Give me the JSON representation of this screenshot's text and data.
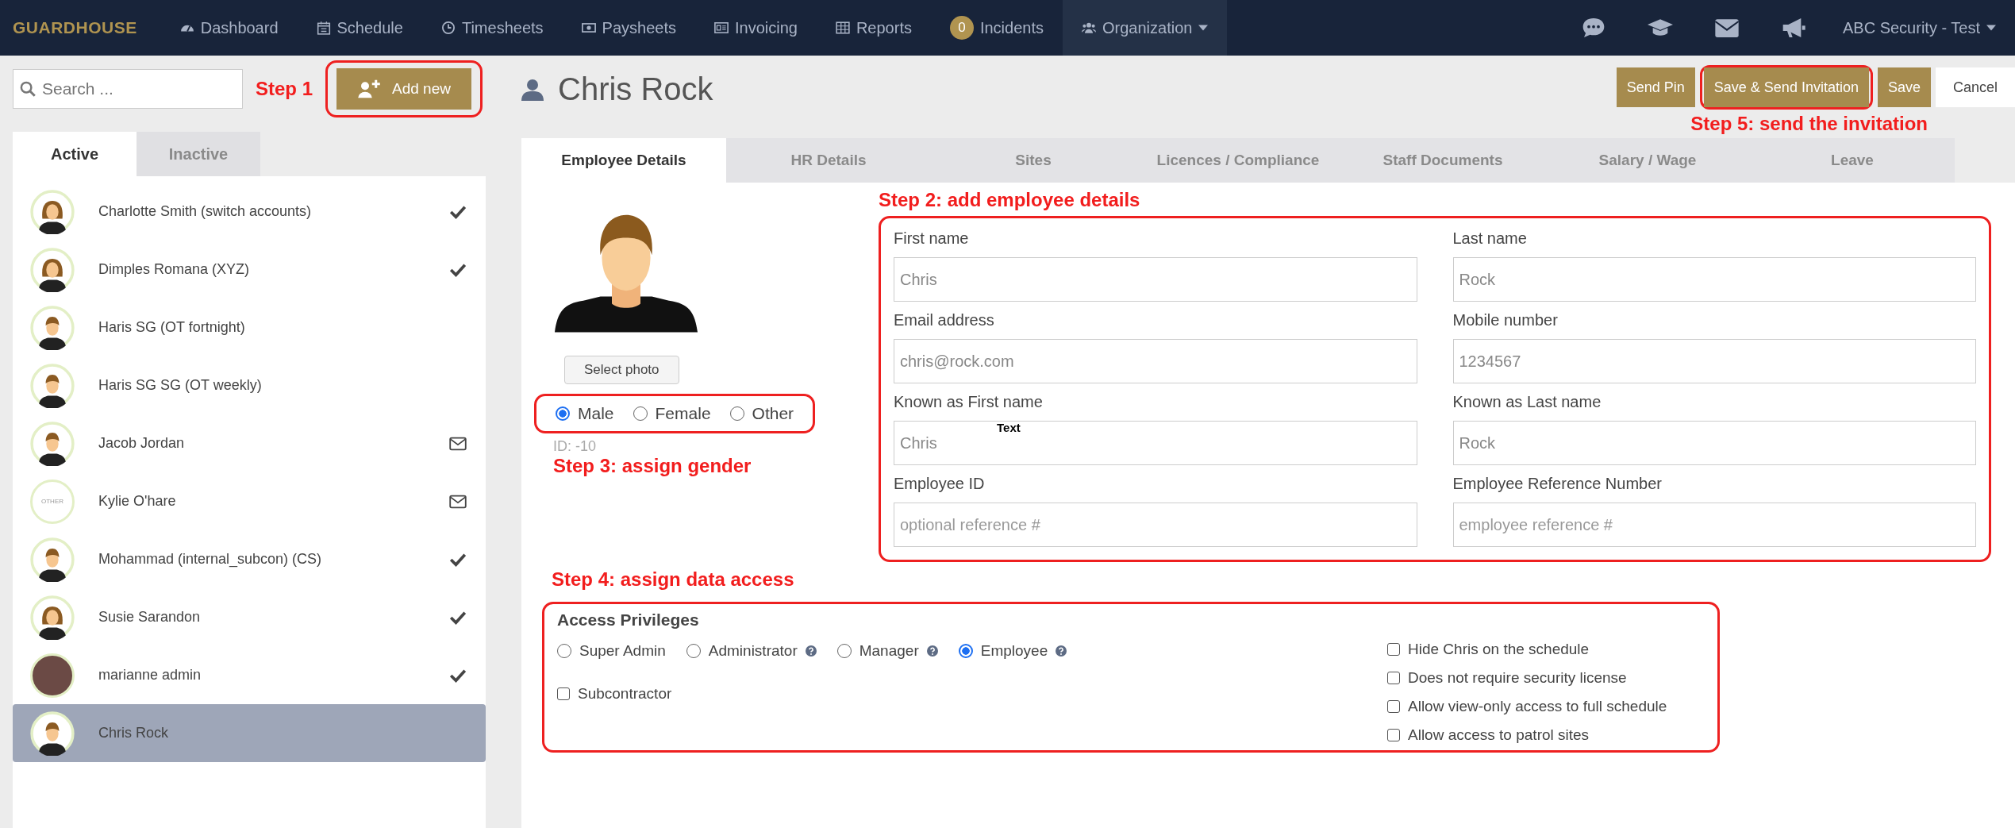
{
  "nav": {
    "brand": "GUARDHOUSE",
    "items": [
      {
        "kind": "dashboard",
        "label": "Dashboard",
        "selected": false
      },
      {
        "kind": "calendar",
        "label": "Schedule",
        "selected": false
      },
      {
        "kind": "clock",
        "label": "Timesheets",
        "selected": false
      },
      {
        "kind": "money",
        "label": "Paysheets",
        "selected": false
      },
      {
        "kind": "invoice",
        "label": "Invoicing",
        "selected": false
      },
      {
        "kind": "table",
        "label": "Reports",
        "selected": false
      },
      {
        "kind": "badge",
        "badge": "0",
        "label": "Incidents",
        "selected": false
      },
      {
        "kind": "users",
        "label": "Organization",
        "selected": true,
        "dropdown": true
      }
    ],
    "tools": [
      {
        "kind": "chat"
      },
      {
        "kind": "cap"
      },
      {
        "kind": "mail"
      },
      {
        "kind": "megaphone"
      }
    ],
    "account": "ABC Security - Test"
  },
  "sidebar": {
    "search": {
      "placeholder": "Search ..."
    },
    "step_note": "Step 1",
    "add_button": "Add new",
    "tabs": [
      {
        "label": "Active",
        "selected": true
      },
      {
        "label": "Inactive",
        "selected": false
      }
    ],
    "people": [
      {
        "name": "Charlotte Smith (switch accounts)",
        "avatar": {
          "kind": "female"
        },
        "status": {
          "kind": "check"
        },
        "selected": false
      },
      {
        "name": "Dimples Romana (XYZ)",
        "avatar": {
          "kind": "female"
        },
        "status": {
          "kind": "check"
        },
        "selected": false
      },
      {
        "name": "Haris SG (OT fortnight)",
        "avatar": {
          "kind": "male"
        },
        "selected": false
      },
      {
        "name": "Haris SG SG (OT weekly)",
        "avatar": {
          "kind": "male"
        },
        "selected": false
      },
      {
        "name": "Jacob Jordan",
        "avatar": {
          "kind": "male"
        },
        "status": {
          "kind": "mail"
        },
        "selected": false
      },
      {
        "name": "Kylie O'hare",
        "avatar": {
          "kind": "other",
          "label": "OTHER"
        },
        "status": {
          "kind": "mail"
        },
        "selected": false
      },
      {
        "name": "Mohammad (internal_subcon) (CS)",
        "avatar": {
          "kind": "male"
        },
        "status": {
          "kind": "check"
        },
        "selected": false
      },
      {
        "name": "Susie Sarandon",
        "avatar": {
          "kind": "female"
        },
        "status": {
          "kind": "check"
        },
        "selected": false
      },
      {
        "name": "marianne admin",
        "avatar": {
          "kind": "photo"
        },
        "status": {
          "kind": "check"
        },
        "selected": false
      },
      {
        "name": "Chris Rock",
        "avatar": {
          "kind": "male"
        },
        "selected": true
      }
    ]
  },
  "header": {
    "title": "Chris Rock",
    "buttons": [
      {
        "kind": "gold",
        "label": "Send Pin"
      },
      {
        "kind": "gold",
        "label": "Save & Send Invitation",
        "highlighted": true
      },
      {
        "kind": "gold",
        "label": "Save"
      },
      {
        "kind": "plain",
        "label": "Cancel"
      }
    ],
    "step_note": "Step 5: send the invitation"
  },
  "tabs": [
    {
      "label": "Employee Details",
      "selected": true
    },
    {
      "label": "HR Details",
      "selected": false
    },
    {
      "label": "Sites",
      "selected": false
    },
    {
      "label": "Licences / Compliance",
      "selected": false
    },
    {
      "label": "Staff Documents",
      "selected": false
    },
    {
      "label": "Salary / Wage",
      "selected": false
    },
    {
      "label": "Leave",
      "selected": false
    }
  ],
  "photo": {
    "button": "Select photo"
  },
  "gender": [
    {
      "label": "Male",
      "selected": true
    },
    {
      "label": "Female",
      "selected": false
    },
    {
      "label": "Other",
      "selected": false
    }
  ],
  "id_text": "ID: -10",
  "step3_note": "Step 3: assign gender",
  "step2_note": "Step 2: add employee details",
  "fields": [
    {
      "label": "First name",
      "value": "Chris"
    },
    {
      "label": "Last name",
      "value": "Rock"
    },
    {
      "label": "Email address",
      "value": "chris@rock.com"
    },
    {
      "label": "Mobile number",
      "value": "1234567"
    },
    {
      "label": "Known as First name",
      "value": "Chris",
      "overlay_text": "Text"
    },
    {
      "label": "Known as Last name",
      "value": "Rock"
    },
    {
      "label": "Employee ID",
      "placeholder": "optional reference #"
    },
    {
      "label": "Employee Reference Number",
      "placeholder": "employee reference #"
    }
  ],
  "step4_note": "Step 4: assign data access",
  "access": {
    "title": "Access Privileges",
    "roles": [
      {
        "label": "Super Admin",
        "selected": false,
        "help": false
      },
      {
        "label": "Administrator",
        "selected": false,
        "help": true
      },
      {
        "label": "Manager",
        "selected": false,
        "help": true
      },
      {
        "label": "Employee",
        "selected": true,
        "help": true
      }
    ],
    "subcontractor": {
      "label": "Subcontractor",
      "checked": false
    },
    "options": [
      {
        "label": "Hide Chris on the schedule",
        "checked": false
      },
      {
        "label": "Does not require security license",
        "checked": false
      },
      {
        "label": "Allow view-only access to full schedule",
        "checked": false
      },
      {
        "label": "Allow access to patrol sites",
        "checked": false
      }
    ]
  }
}
